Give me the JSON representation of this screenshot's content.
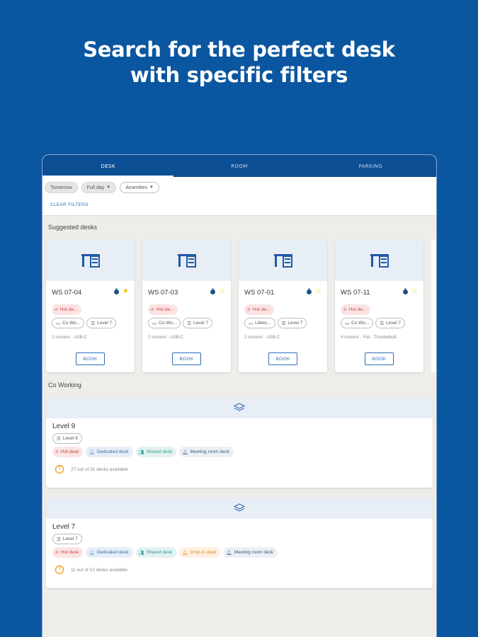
{
  "headline": {
    "line1": "Search for the perfect desk",
    "line2": "with specific filters"
  },
  "tabs": [
    {
      "label": "DESK",
      "active": true
    },
    {
      "label": "ROOM",
      "active": false
    },
    {
      "label": "PARKING",
      "active": false
    }
  ],
  "filters": {
    "chips": [
      "Tomorrow",
      "Full day",
      "Amenities"
    ],
    "clear_label": "CLEAR FILTERS"
  },
  "suggested": {
    "title": "Suggested desks",
    "cards": [
      {
        "name": "WS 07-04",
        "favorite": true,
        "type": "Hot de...",
        "zone": "Co Wo...",
        "level": "Level 7",
        "desc": "2 screens · USB-C",
        "book": "BOOK"
      },
      {
        "name": "WS 07-03",
        "favorite": false,
        "type": "Hot de...",
        "zone": "Co Wo...",
        "level": "Level 7",
        "desc": "2 screens · USB-C",
        "book": "BOOK"
      },
      {
        "name": "WS 07-01",
        "favorite": false,
        "type": "Hot de...",
        "zone": "Lilleto...",
        "level": "Level 7",
        "desc": "2 screens · USB-C",
        "book": "BOOK"
      },
      {
        "name": "WS 07-11",
        "favorite": false,
        "type": "Hot de...",
        "zone": "Co Wo...",
        "level": "Level 7",
        "desc": "4 screens · Flat · Thunderbolt",
        "book": "BOOK"
      }
    ]
  },
  "coworking": {
    "title": "Co Working",
    "levels": [
      {
        "title": "Level 9",
        "chip": "Level 9",
        "types": [
          "Hot desk",
          "Dedicated desk",
          "Shared desk",
          "Meeting room desk"
        ],
        "availability": "27 out of 31 desks available",
        "avail_fraction": 0.87
      },
      {
        "title": "Level 7",
        "chip": "Level 7",
        "types": [
          "Hot desk",
          "Dedicated desk",
          "Shared desk",
          "Drop-in desk",
          "Meeting room desk"
        ],
        "availability": "11 out of 12 desks available",
        "avail_fraction": 0.92
      }
    ]
  },
  "colors": {
    "brand_blue": "#0a56a0",
    "tabbar": "#0d4f94",
    "hot": "#d04040",
    "accent_orange": "#f5a623",
    "star": "#f5c100"
  }
}
